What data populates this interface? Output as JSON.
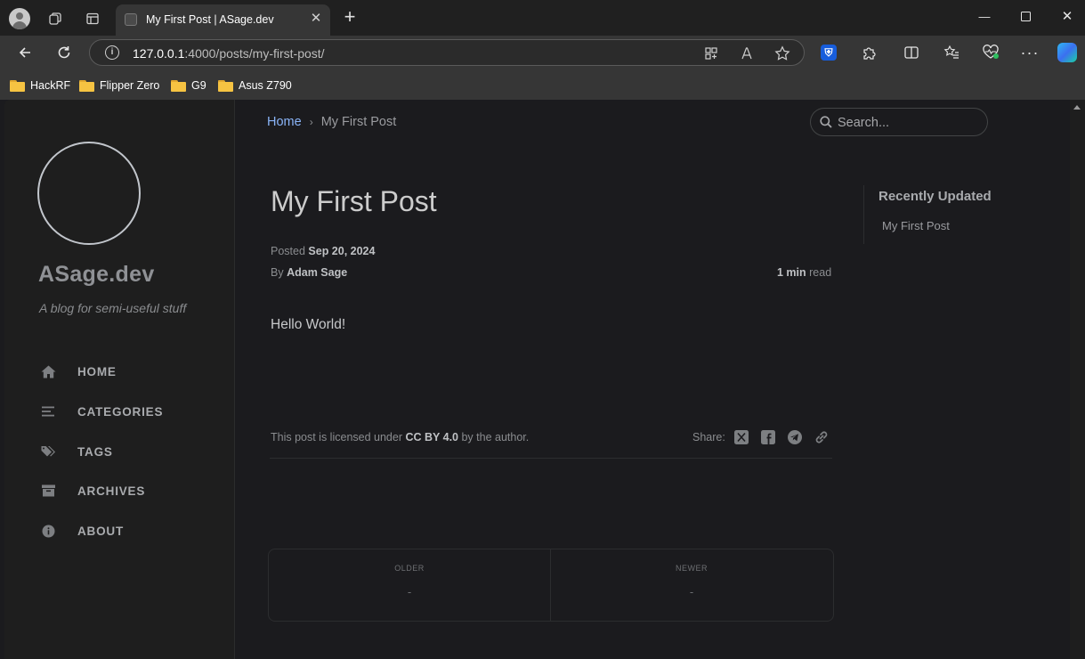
{
  "browser": {
    "tab_title": "My First Post | ASage.dev",
    "url_host": "127.0.0.1",
    "url_rest": ":4000/posts/my-first-post/",
    "bookmarks": [
      "HackRF",
      "Flipper Zero",
      "G9",
      "Asus Z790"
    ]
  },
  "sidebar": {
    "site_title": "ASage.dev",
    "subtitle": "A blog for semi-useful stuff",
    "nav": [
      {
        "label": "HOME",
        "icon": "home-icon"
      },
      {
        "label": "CATEGORIES",
        "icon": "categories-icon"
      },
      {
        "label": "TAGS",
        "icon": "tags-icon"
      },
      {
        "label": "ARCHIVES",
        "icon": "archive-icon"
      },
      {
        "label": "ABOUT",
        "icon": "info-icon"
      }
    ]
  },
  "topbar": {
    "breadcrumb_home": "Home",
    "breadcrumb_sep": "›",
    "breadcrumb_current": "My First Post",
    "search_placeholder": "Search..."
  },
  "post": {
    "title": "My First Post",
    "posted_label": "Posted",
    "posted_date": "Sep 20, 2024",
    "by_label": "By",
    "author": "Adam Sage",
    "read_time": "1 min",
    "read_label": "read",
    "body": "Hello World!",
    "license_prefix": "This post is licensed under",
    "license_name": "CC BY 4.0",
    "license_suffix": "by the author.",
    "share_label": "Share:"
  },
  "pager": {
    "older_label": "OLDER",
    "older_value": "-",
    "newer_label": "NEWER",
    "newer_value": "-"
  },
  "panel": {
    "heading": "Recently Updated",
    "items": [
      "My First Post"
    ]
  },
  "colors": {
    "link": "#8ab4f8",
    "background": "#1b1b1e",
    "sidebar": "#1e1e1e"
  }
}
